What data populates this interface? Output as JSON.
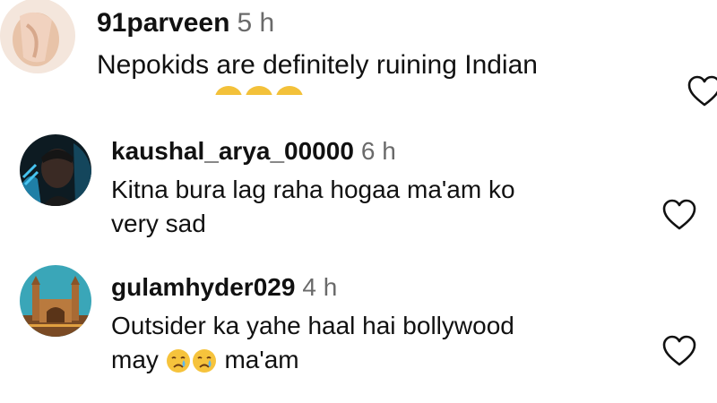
{
  "comments": [
    {
      "username": "91parveen",
      "time": "5 h",
      "text": "Nepokids are definitely ruining Indian",
      "avatar_icon": "avatar-beige-photo",
      "emoji_icon": "face-emoji"
    },
    {
      "username": "kaushal_arya_00000",
      "time": "6 h",
      "text_line1": "Kitna bura lag raha hogaa ma'am ko",
      "text_line2": "very sad",
      "avatar_icon": "avatar-dark-photo"
    },
    {
      "username": "gulamhyder029",
      "time": "4 h",
      "text_line1": "Outsider ka yahe haal hai bollywood",
      "text_line2_before": "may",
      "text_line2_after": "ma'am",
      "emoji_icon": "crying-face-emoji",
      "avatar_icon": "avatar-monument-photo"
    }
  ],
  "icons": {
    "like": "heart-outline-icon"
  },
  "colors": {
    "text": "#111111",
    "timestamp": "#6a6a6a",
    "icon_stroke": "#111111"
  }
}
